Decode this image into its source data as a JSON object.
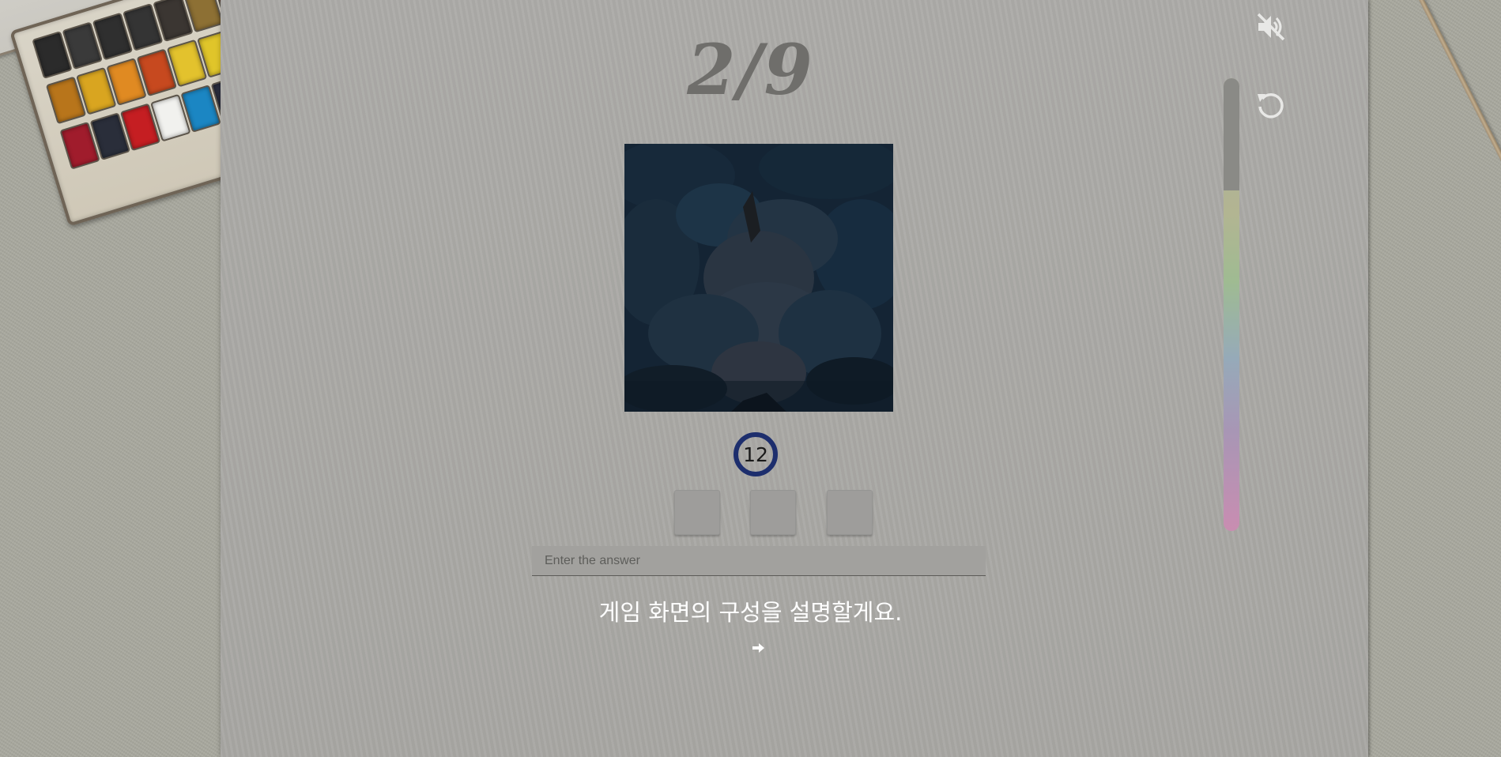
{
  "progress": {
    "current": 2,
    "total": 9,
    "label": "2/9"
  },
  "timer": {
    "seconds": "12",
    "ring_color": "#1d2e6d"
  },
  "answer": {
    "placeholder": "Enter the answer",
    "value": ""
  },
  "answer_slots": {
    "count": 3
  },
  "tutorial": {
    "message": "게임 화면의 구성을 설명할게요."
  },
  "icons": {
    "mute": "volume-mute-icon",
    "restart": "restart-icon",
    "next": "arrow-right-icon"
  },
  "colors": {
    "paper": "#acaba8",
    "desk": "#a8a89e",
    "artwork_base": "#132331",
    "counter_text": "#6f6e6b",
    "tutorial_text": "#ffffff"
  },
  "palette_colors": [
    "#2b2b2b",
    "#3a3a3a",
    "#2f2f2f",
    "#343434",
    "#3b3632",
    "#8d7034",
    "#5e3a2c",
    "#202a5c",
    "#3c4660",
    "#1a4a34",
    "#1f2d24",
    "#1e7a34",
    "#b8751b",
    "#d9a520",
    "#e08a22",
    "#c7491f",
    "#e3c22d",
    "#e0c52a",
    "#5c7826",
    "#232323",
    "#3d3a56",
    "#4a4d5e",
    "#b58f2a",
    "#1f1f1f",
    "#a01c2c",
    "#2a2e3a",
    "#c51e22",
    "#f1f1ee",
    "#1b86c3",
    "#2c2f3f",
    "#d94f1d",
    "#3b3a3a",
    "#2b304b",
    "#8f8228",
    "#2f5e26",
    "#141414"
  ]
}
